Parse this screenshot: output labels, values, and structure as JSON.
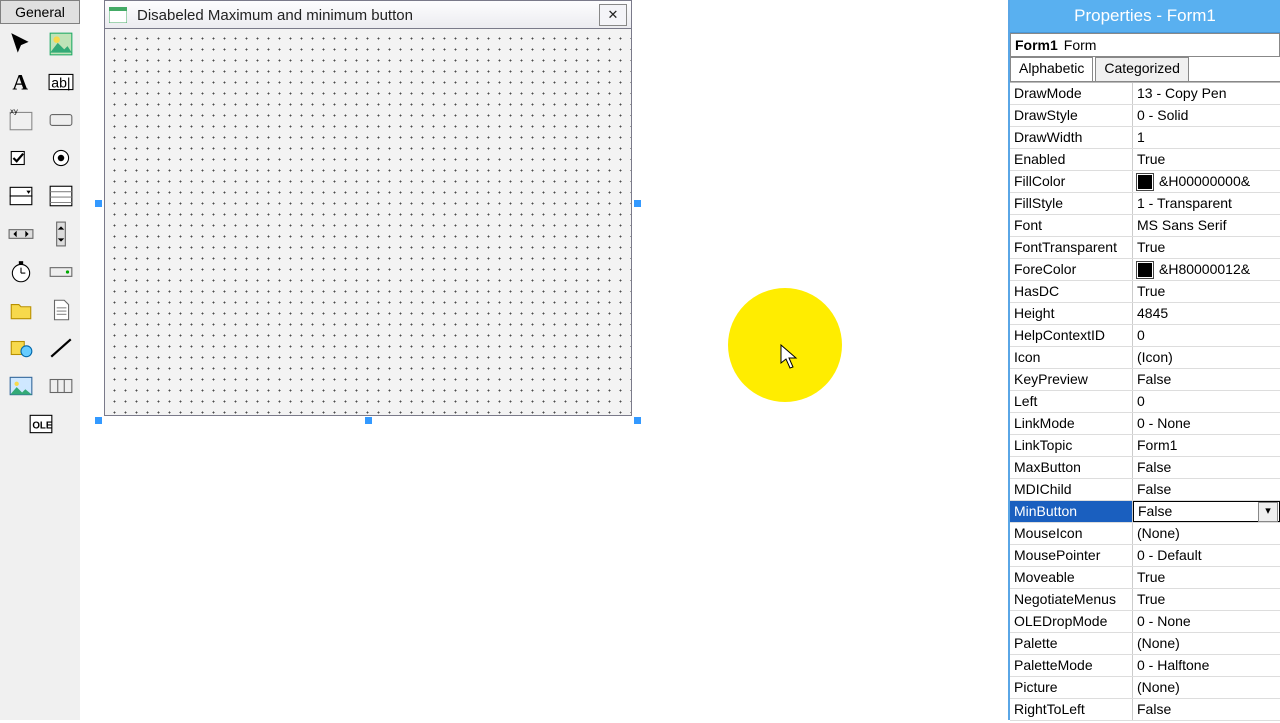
{
  "toolbox": {
    "tab": "General"
  },
  "form": {
    "caption": "Disabeled Maximum and minimum button",
    "close": "✕"
  },
  "properties": {
    "title": "Properties - Form1",
    "objectName": "Form1",
    "objectType": "Form",
    "tabs": {
      "alpha": "Alphabetic",
      "cat": "Categorized"
    },
    "selectedRow": "MinButton",
    "rows": [
      {
        "name": "DrawMode",
        "value": "13 - Copy Pen"
      },
      {
        "name": "DrawStyle",
        "value": "0 - Solid"
      },
      {
        "name": "DrawWidth",
        "value": "1"
      },
      {
        "name": "Enabled",
        "value": "True"
      },
      {
        "name": "FillColor",
        "value": "&H00000000&",
        "swatch": true
      },
      {
        "name": "FillStyle",
        "value": "1 - Transparent"
      },
      {
        "name": "Font",
        "value": "MS Sans Serif"
      },
      {
        "name": "FontTransparent",
        "value": "True"
      },
      {
        "name": "ForeColor",
        "value": "&H80000012&",
        "swatch": true
      },
      {
        "name": "HasDC",
        "value": "True"
      },
      {
        "name": "Height",
        "value": "4845"
      },
      {
        "name": "HelpContextID",
        "value": "0"
      },
      {
        "name": "Icon",
        "value": "(Icon)"
      },
      {
        "name": "KeyPreview",
        "value": "False"
      },
      {
        "name": "Left",
        "value": "0"
      },
      {
        "name": "LinkMode",
        "value": "0 - None"
      },
      {
        "name": "LinkTopic",
        "value": "Form1"
      },
      {
        "name": "MaxButton",
        "value": "False"
      },
      {
        "name": "MDIChild",
        "value": "False"
      },
      {
        "name": "MinButton",
        "value": "False"
      },
      {
        "name": "MouseIcon",
        "value": "(None)"
      },
      {
        "name": "MousePointer",
        "value": "0 - Default"
      },
      {
        "name": "Moveable",
        "value": "True"
      },
      {
        "name": "NegotiateMenus",
        "value": "True"
      },
      {
        "name": "OLEDropMode",
        "value": "0 - None"
      },
      {
        "name": "Palette",
        "value": "(None)"
      },
      {
        "name": "PaletteMode",
        "value": "0 - Halftone"
      },
      {
        "name": "Picture",
        "value": "(None)"
      },
      {
        "name": "RightToLeft",
        "value": "False"
      }
    ]
  }
}
